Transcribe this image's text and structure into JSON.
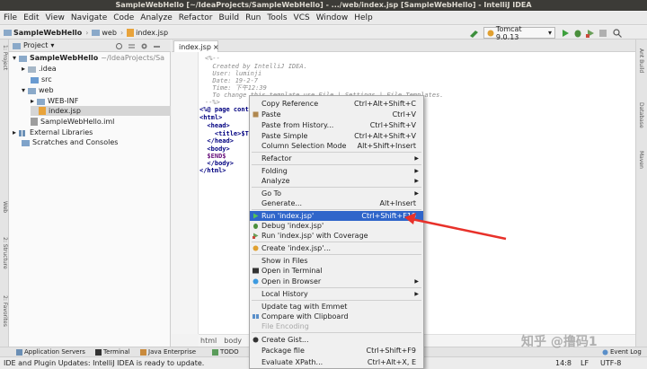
{
  "window": {
    "title": "SampleWebHello [~/IdeaProjects/SampleWebHello] - .../web/index.jsp [SampleWebHello] - IntelliJ IDEA"
  },
  "menubar": [
    "File",
    "Edit",
    "View",
    "Navigate",
    "Code",
    "Analyze",
    "Refactor",
    "Build",
    "Run",
    "Tools",
    "VCS",
    "Window",
    "Help"
  ],
  "navbar": {
    "crumbs": [
      "SampleWebHello",
      "web",
      "index.jsp"
    ],
    "run_config": "Tomcat 9.0.13"
  },
  "project": {
    "header": "Project",
    "tree": [
      {
        "label": "SampleWebHello",
        "extra": "~/IdeaProjects/Sa"
      },
      {
        "label": ".idea"
      },
      {
        "label": "src"
      },
      {
        "label": "web"
      },
      {
        "label": "WEB-INF"
      },
      {
        "label": "index.jsp"
      },
      {
        "label": "SampleWebHello.iml"
      },
      {
        "label": "External Libraries"
      },
      {
        "label": "Scratches and Consoles"
      }
    ]
  },
  "editor": {
    "tab": "index.jsp",
    "lines": [
      "<%--",
      "  Created by IntelliJ IDEA.",
      "  User: luminji",
      "  Date: 19-2-7",
      "  Time: 下午12:39",
      "  To change this template use File | Settings | File Templates.",
      "--%>",
      "<%@ page conter",
      "<html>",
      "  <head>",
      "    <title>$Tit",
      "  </head>",
      "  <body>",
      "  $END$",
      "  </body>",
      "</html>"
    ],
    "breadcrumbs": [
      "html",
      "body"
    ]
  },
  "context_menu": {
    "items": [
      {
        "label": "Copy Reference",
        "shortcut": "Ctrl+Alt+Shift+C"
      },
      {
        "label": "Paste",
        "shortcut": "Ctrl+V"
      },
      {
        "label": "Paste from History...",
        "shortcut": "Ctrl+Shift+V"
      },
      {
        "label": "Paste Simple",
        "shortcut": "Ctrl+Alt+Shift+V"
      },
      {
        "label": "Column Selection Mode",
        "shortcut": "Alt+Shift+Insert"
      },
      {
        "label": "Refactor",
        "shortcut": ""
      },
      {
        "label": "Folding",
        "shortcut": ""
      },
      {
        "label": "Analyze",
        "shortcut": ""
      },
      {
        "label": "Go To",
        "shortcut": ""
      },
      {
        "label": "Generate...",
        "shortcut": "Alt+Insert"
      },
      {
        "label": "Run 'index.jsp'",
        "shortcut": "Ctrl+Shift+F10"
      },
      {
        "label": "Debug 'index.jsp'",
        "shortcut": ""
      },
      {
        "label": "Run 'index.jsp' with Coverage",
        "shortcut": ""
      },
      {
        "label": "Create 'index.jsp'...",
        "shortcut": ""
      },
      {
        "label": "Show in Files",
        "shortcut": ""
      },
      {
        "label": "Open in Terminal",
        "shortcut": ""
      },
      {
        "label": "Open in Browser",
        "shortcut": ""
      },
      {
        "label": "Local History",
        "shortcut": ""
      },
      {
        "label": "Update tag with Emmet",
        "shortcut": ""
      },
      {
        "label": "Compare with Clipboard",
        "shortcut": ""
      },
      {
        "label": "File Encoding",
        "shortcut": ""
      },
      {
        "label": "Create Gist...",
        "shortcut": ""
      },
      {
        "label": "Package file",
        "shortcut": "Ctrl+Shift+F9"
      },
      {
        "label": "Evaluate XPath...",
        "shortcut": "Ctrl+Alt+X, E"
      }
    ]
  },
  "bottom_tabs": [
    "Application Servers",
    "Terminal",
    "Java Enterprise",
    "TODO",
    "Event Log"
  ],
  "status": {
    "message": "IDE and Plugin Updates: IntelliJ IDEA is ready to update.",
    "position": "14:8",
    "line_sep": "LF",
    "encoding": "UTF-8"
  },
  "side_labels": {
    "left_top": "1: Project",
    "left_mid": "2: Structure",
    "left_low": "2: Favorites",
    "left_web": "Web",
    "right_top": "Ant Build",
    "right_mid": "Database",
    "right_low": "Maven"
  },
  "watermark": "知乎 @撸码1",
  "colors": {
    "selection": "#2f65ca",
    "arrow": "#e8312a"
  }
}
